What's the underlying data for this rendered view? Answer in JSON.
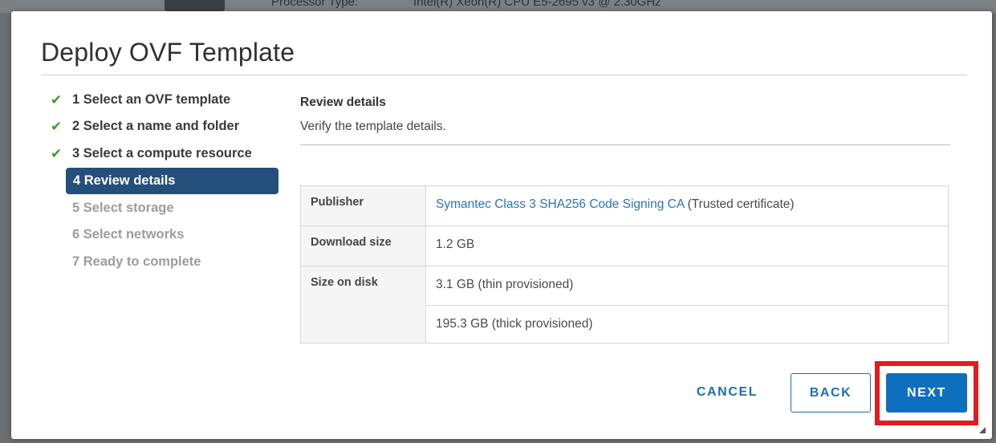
{
  "background": {
    "label": "Processor Type:",
    "value": "Intel(R) Xeon(R) CPU E5-2695 v3 @ 2.30GHz"
  },
  "dialog": {
    "title": "Deploy OVF Template"
  },
  "steps": [
    {
      "label": "1 Select an OVF template",
      "state": "done"
    },
    {
      "label": "2 Select a name and folder",
      "state": "done"
    },
    {
      "label": "3 Select a compute resource",
      "state": "done"
    },
    {
      "label": "4 Review details",
      "state": "active"
    },
    {
      "label": "5 Select storage",
      "state": "pending"
    },
    {
      "label": "6 Select networks",
      "state": "pending"
    },
    {
      "label": "7 Ready to complete",
      "state": "pending"
    }
  ],
  "check_glyph": "✔",
  "pane": {
    "title": "Review details",
    "subtitle": "Verify the template details."
  },
  "details": {
    "publisher_label": "Publisher",
    "publisher_link": "Symantec Class 3 SHA256 Code Signing CA",
    "publisher_note": " (Trusted certificate)",
    "download_label": "Download size",
    "download_value": "1.2 GB",
    "disk_label": "Size on disk",
    "disk_thin": "3.1 GB (thin provisioned)",
    "disk_thick": "195.3 GB (thick provisioned)"
  },
  "buttons": {
    "cancel": "CANCEL",
    "back": "BACK",
    "next": "NEXT"
  },
  "colors": {
    "active_step": "#244f7b",
    "check": "#3c9a2f",
    "primary": "#0f6fbf",
    "highlight": "#e11c1c",
    "link": "#2a74b8"
  }
}
